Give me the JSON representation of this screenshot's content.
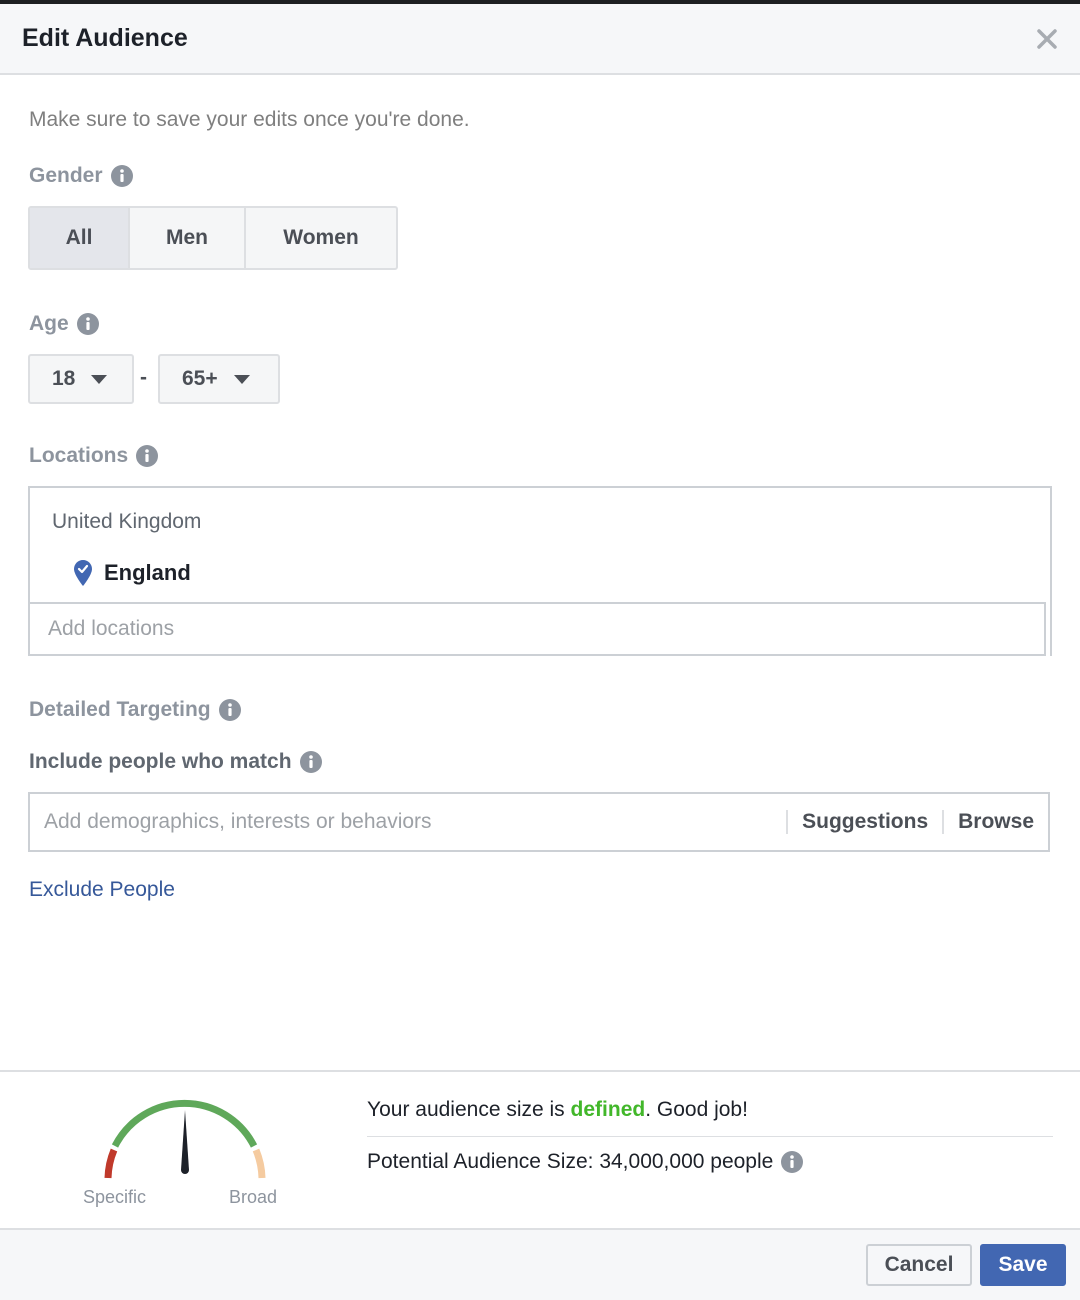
{
  "dialog": {
    "title": "Edit Audience",
    "hint": "Make sure to save your edits once you're done."
  },
  "gender": {
    "label": "Gender",
    "options": [
      "All",
      "Men",
      "Women"
    ],
    "selected": "All"
  },
  "age": {
    "label": "Age",
    "min": "18",
    "separator": "-",
    "max": "65+"
  },
  "locations": {
    "label": "Locations",
    "country": "United Kingdom",
    "selected_region": "England",
    "placeholder": "Add locations"
  },
  "detailed_targeting": {
    "label": "Detailed Targeting",
    "include_label": "Include people who match",
    "placeholder": "Add demographics, interests or behaviors",
    "suggestions_label": "Suggestions",
    "browse_label": "Browse",
    "exclude_link": "Exclude People"
  },
  "audience": {
    "gauge_specific": "Specific",
    "gauge_broad": "Broad",
    "status_prefix": "Your audience size is ",
    "status_word": "defined",
    "status_suffix": ". Good job!",
    "potential_size": "Potential Audience Size: 34,000,000 people",
    "gauge_level": 0.5
  },
  "buttons": {
    "cancel": "Cancel",
    "save": "Save"
  },
  "colors": {
    "accent": "#4267b2",
    "link": "#365899",
    "good": "#42b72a",
    "gauge_red": "#c0392b",
    "gauge_green": "#5fa85a",
    "gauge_orange": "#f5cba0"
  }
}
